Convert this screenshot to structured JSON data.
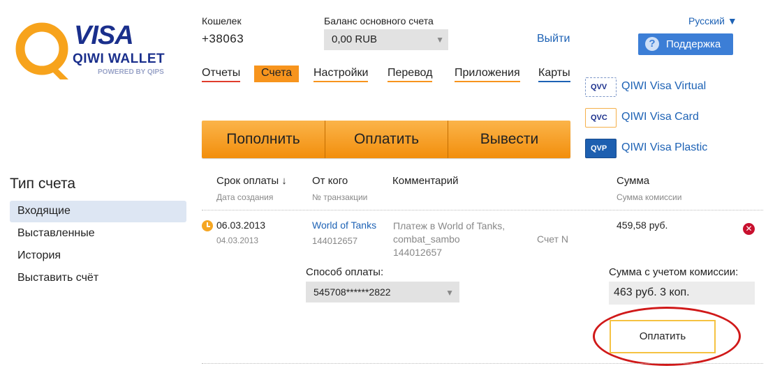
{
  "logo": {
    "visa": "VISA",
    "qiwi": "QIWI WALLET",
    "powered": "POWERED BY QIPS"
  },
  "header": {
    "wallet_label": "Кошелек",
    "wallet_value": "+38063",
    "balance_label": "Баланс основного счета",
    "balance_value": "0,00 RUB",
    "logout": "Выйти",
    "language": "Русский ▼",
    "support": "Поддержка"
  },
  "nav": [
    {
      "label": "Отчеты",
      "underline": "#e03c2c"
    },
    {
      "label": "Счета",
      "active": true
    },
    {
      "label": "Настройки",
      "underline": "#f7941d"
    },
    {
      "label": "Перевод",
      "underline": "#f7941d"
    },
    {
      "label": "Приложения",
      "underline": "#f7941d"
    },
    {
      "label": "Карты",
      "underline": "#1d62b5"
    }
  ],
  "actions": {
    "topup": "Пополнить",
    "pay": "Оплатить",
    "withdraw": "Вывести"
  },
  "cards": [
    {
      "code": "QVV",
      "label": "QIWI Visa Virtual"
    },
    {
      "code": "QVC",
      "label": "QIWI Visa Card"
    },
    {
      "code": "QVP",
      "label": "QIWI Visa Plastic"
    }
  ],
  "sidebar": {
    "title": "Тип счета",
    "items": [
      {
        "label": "Входящие",
        "active": true
      },
      {
        "label": "Выставленные"
      },
      {
        "label": "История"
      },
      {
        "label": "Выставить счёт"
      }
    ]
  },
  "table": {
    "headers": {
      "due": "Срок оплаты ↓",
      "due_sub": "Дата создания",
      "from": "От кого",
      "from_sub": "№ транзакции",
      "comment": "Комментарий",
      "amount": "Сумма",
      "amount_sub": "Сумма комиссии"
    },
    "row": {
      "due_date": "06.03.2013",
      "created_date": "04.03.2013",
      "from": "World of Tanks",
      "transaction": "144012657",
      "comment_line1": "Платеж в World of Tanks,",
      "comment_line2": "combat_sambo",
      "comment_line3": "144012657",
      "invoice": "Счет N",
      "amount": "459,58 руб."
    },
    "payment": {
      "method_label": "Способ оплаты:",
      "method_value": "545708******2822",
      "total_label": "Сумма с учетом комиссии:",
      "total_value": "463 руб. 3 коп.",
      "pay_button": "Оплатить"
    }
  },
  "colors": {
    "accent": "#f7941d",
    "link": "#1d62b5",
    "brand": "#1a2f8c",
    "highlight": "#d01919"
  }
}
